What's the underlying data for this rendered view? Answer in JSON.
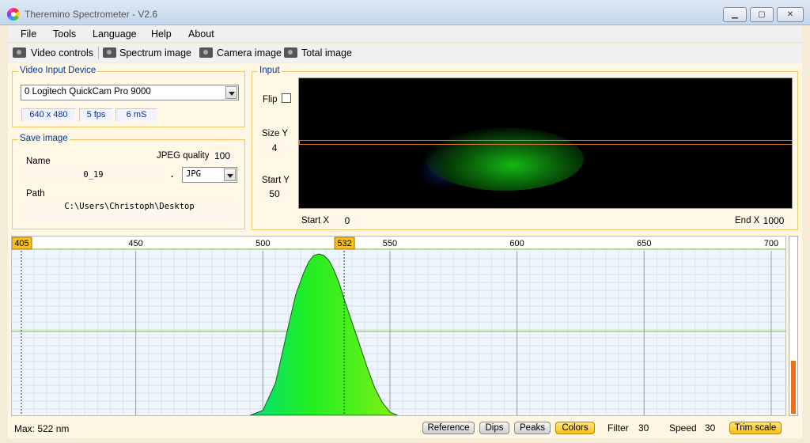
{
  "window": {
    "title": "Theremino Spectrometer - V2.6",
    "min": "▁",
    "max": "▢",
    "close": "✕"
  },
  "menu": [
    "File",
    "Tools",
    "Language",
    "Help",
    "About"
  ],
  "toolbar": {
    "video_controls": "Video controls",
    "spectrum_image": "Spectrum image",
    "camera_image": "Camera image",
    "total_image": "Total image"
  },
  "video_input": {
    "title": "Video Input Device",
    "device": "0 Logitech QuickCam Pro 9000",
    "resolution": "640 x 480",
    "fps": "5 fps",
    "ms": "6 mS"
  },
  "save_image": {
    "title": "Save image",
    "name_label": "Name",
    "name_value": "0_19",
    "dot": ".",
    "jpeg_label": "JPEG quality",
    "jpeg_value": "100",
    "format": "JPG",
    "path_label": "Path",
    "path_value": "C:\\Users\\Christoph\\Desktop"
  },
  "input": {
    "title": "Input",
    "flip_label": "Flip",
    "size_y_label": "Size Y",
    "size_y_value": "4",
    "start_y_label": "Start Y",
    "start_y_value": "50",
    "start_x_label": "Start X",
    "start_x_value": "0",
    "end_x_label": "End X",
    "end_x_value": "1000"
  },
  "chart_data": {
    "type": "area",
    "x_ticks": [
      405,
      450,
      500,
      550,
      600,
      650,
      700
    ],
    "xlim": [
      405,
      705
    ],
    "ylim": [
      0,
      100
    ],
    "cursor_left": 405,
    "cursor_peak": 532,
    "series": [
      {
        "x": [
          495,
          500,
          505,
          510,
          513,
          516,
          518,
          520,
          522,
          524,
          526,
          528,
          530,
          532,
          535,
          538,
          541,
          544,
          547,
          550,
          553
        ],
        "values": [
          0,
          3,
          20,
          55,
          75,
          88,
          95,
          99,
          100,
          99,
          96,
          90,
          82,
          72,
          58,
          44,
          30,
          17,
          8,
          2,
          0
        ]
      }
    ]
  },
  "status": {
    "max_label": "Max: 522 nm",
    "reference": "Reference",
    "dips": "Dips",
    "peaks": "Peaks",
    "colors": "Colors",
    "filter_label": "Filter",
    "filter_value": "30",
    "speed_label": "Speed",
    "speed_value": "30",
    "trim_scale": "Trim scale",
    "level": 0.3
  }
}
